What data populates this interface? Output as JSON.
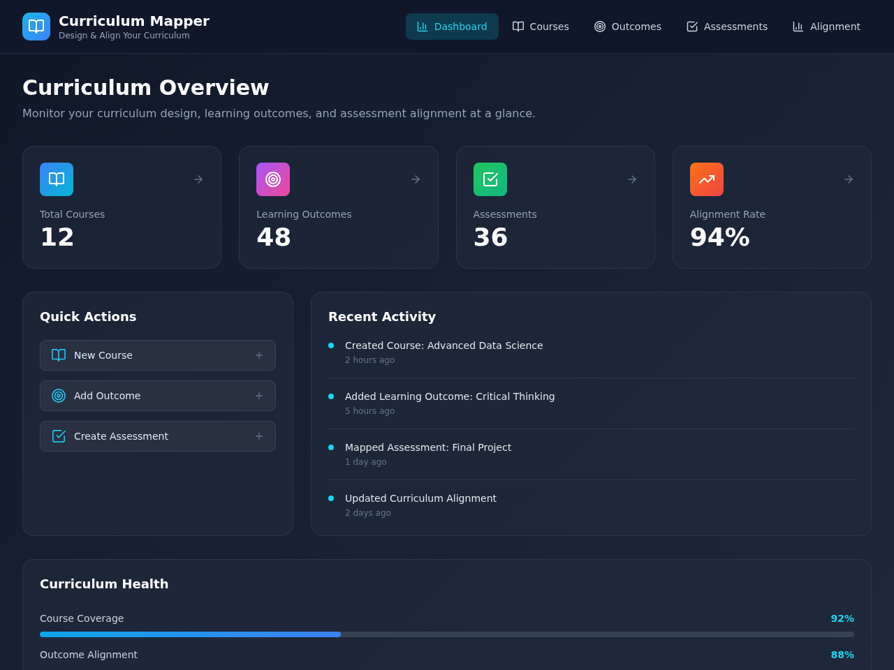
{
  "app": {
    "title": "Curriculum Mapper",
    "subtitle": "Design & Align Your Curriculum"
  },
  "nav": [
    {
      "label": "Dashboard",
      "selected": true
    },
    {
      "label": "Courses",
      "selected": false
    },
    {
      "label": "Outcomes",
      "selected": false
    },
    {
      "label": "Assessments",
      "selected": false
    },
    {
      "label": "Alignment",
      "selected": false
    }
  ],
  "page": {
    "title": "Curriculum Overview",
    "subtitle": "Monitor your curriculum design, learning outcomes, and assessment alignment at a glance."
  },
  "stats": [
    {
      "label": "Total Courses",
      "value": "12"
    },
    {
      "label": "Learning Outcomes",
      "value": "48"
    },
    {
      "label": "Assessments",
      "value": "36"
    },
    {
      "label": "Alignment Rate",
      "value": "94%"
    }
  ],
  "quick_actions": {
    "title": "Quick Actions",
    "actions": [
      "New Course",
      "Add Outcome",
      "Create Assessment"
    ]
  },
  "recent_activity": {
    "title": "Recent Activity",
    "items": [
      {
        "text": "Created Course: Advanced Data Science",
        "time": "2 hours ago"
      },
      {
        "text": "Added Learning Outcome: Critical Thinking",
        "time": "5 hours ago"
      },
      {
        "text": "Mapped Assessment: Final Project",
        "time": "1 day ago"
      },
      {
        "text": "Updated Curriculum Alignment",
        "time": "2 days ago"
      }
    ]
  },
  "curriculum_health": {
    "title": "Curriculum Health",
    "metrics": [
      {
        "label": "Course Coverage",
        "value": "92%",
        "level": 0.37
      },
      {
        "label": "Outcome Alignment",
        "value": "88%"
      }
    ]
  }
}
